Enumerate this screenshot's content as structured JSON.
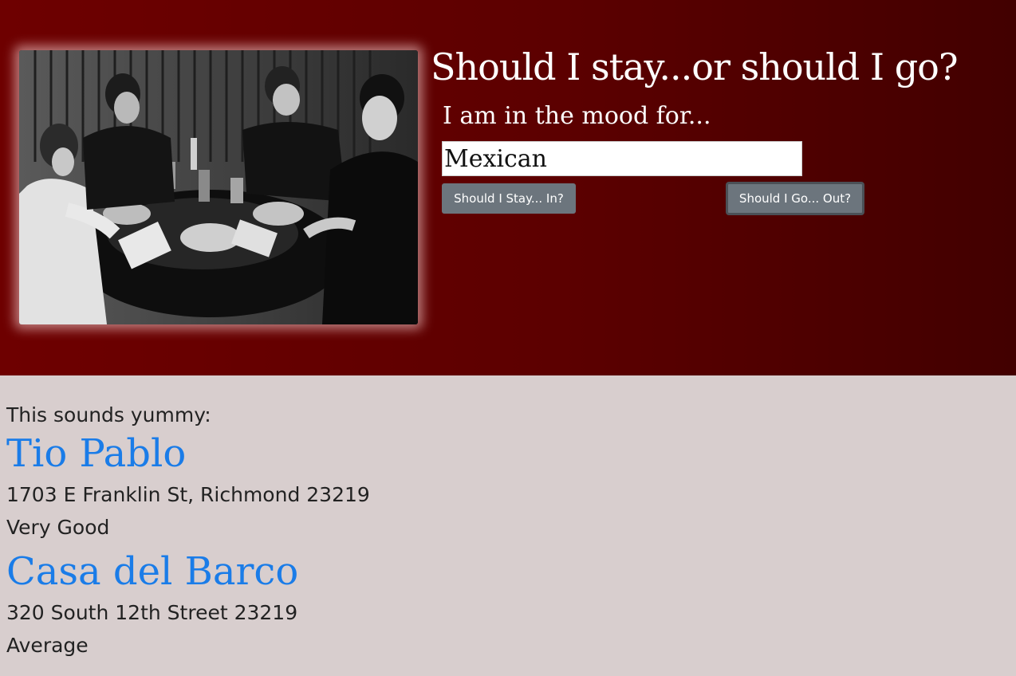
{
  "header": {
    "title": "Should I stay...or should I go?",
    "mood_label": "I am in the mood for...",
    "mood_input_value": "Mexican",
    "stay_button_label": "Should I Stay... In?",
    "go_button_label": "Should I Go... Out?"
  },
  "photo": {
    "subject": "black-and-white photo of four men eating at a restaurant table"
  },
  "results": {
    "intro": "This sounds yummy:",
    "restaurants": [
      {
        "name": "Tio Pablo",
        "address": "1703 E Franklin St, Richmond 23219",
        "rating": "Very Good"
      },
      {
        "name": "Casa del Barco",
        "address": "320 South 12th Street 23219",
        "rating": "Average"
      }
    ]
  },
  "colors": {
    "header_gradient_start": "#6e0000",
    "header_gradient_end": "#420000",
    "page_background": "#d8cece",
    "link_blue": "#1a7ce8",
    "button_gray": "#6c757d"
  }
}
